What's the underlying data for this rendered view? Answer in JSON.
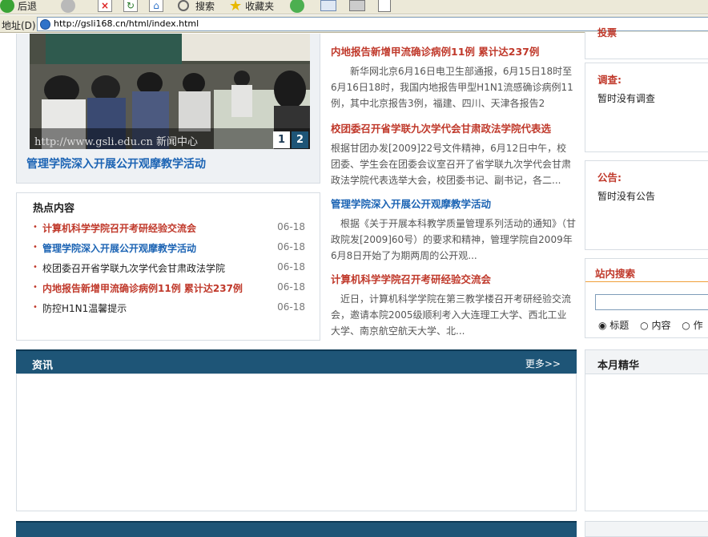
{
  "browser": {
    "back_label": "后退",
    "search_label": "搜索",
    "favorites_label": "收藏夹",
    "address_label": "地址(D)",
    "url": "http://gsli168.cn/html/index.html"
  },
  "slideshow": {
    "caption": "管理学院深入开展公开观摩教学活动",
    "watermark": "http://www.gsli.edu.cn 新闻中心",
    "pages": [
      "1",
      "2"
    ]
  },
  "hot": {
    "title": "热点内容",
    "items": [
      {
        "text": "计算机科学学院召开考研经验交流会",
        "date": "06-18",
        "color": "#c0392b",
        "bold": true
      },
      {
        "text": "管理学院深入开展公开观摩教学活动",
        "date": "06-18",
        "color": "#1c64b4",
        "bold": true
      },
      {
        "text": "校团委召开省学联九次学代会甘肃政法学院",
        "date": "06-18",
        "color": "#222222",
        "bold": false
      },
      {
        "text": "内地报告新增甲流确诊病例11例 累计达237例",
        "date": "06-18",
        "color": "#c0392b",
        "bold": true
      },
      {
        "text": "防控H1N1温馨提示",
        "date": "06-18",
        "color": "#222222",
        "bold": false
      }
    ]
  },
  "news": [
    {
      "title": "内地报告新增甲流确诊病例11例 累计达237例",
      "color": "#c0392b",
      "body": "　　新华网北京6月16日电卫生部通报，6月15日18时至6月16日18时，我国内地报告甲型H1N1流感确诊病例11例，其中北京报告3例，福建、四川、天津各报告2"
    },
    {
      "title": "校团委召开省学联九次学代会甘肃政法学院代表选",
      "color": "#c0392b",
      "body": "根据甘团办发[2009]22号文件精神，6月12日中午，校团委、学生会在团委会议室召开了省学联九次学代会甘肃政法学院代表选举大会，校团委书记、副书记，各二..."
    },
    {
      "title": "管理学院深入开展公开观摩教学活动",
      "color": "#1c64b4",
      "body": "　根据《关于开展本科教学质量管理系列活动的通知》（甘政院发[2009]60号）的要求和精神，管理学院自2009年6月8日开始了为期两周的公开观..."
    },
    {
      "title": "计算机科学学院召开考研经验交流会",
      "color": "#c0392b",
      "body": "　近日，计算机科学学院在第三教学楼召开考研经验交流会，邀请本院2005级顺利考入大连理工大学、西北工业大学、南京航空航天大学、北..."
    }
  ],
  "right": {
    "top_label": "投票",
    "survey_title": "调查:",
    "survey_text": "暂时没有调查",
    "notice_title": "公告:",
    "notice_text": "暂时没有公告",
    "search_title": "站内搜索",
    "search_options": [
      "标题",
      "内容",
      "作"
    ],
    "monthly_title": "本月精华"
  },
  "sections": {
    "info_label": "资讯",
    "more_label": "更多>>"
  },
  "colors": {
    "accent_red": "#c0392b",
    "accent_blue": "#1c64b4",
    "bar": "#1e5577"
  }
}
